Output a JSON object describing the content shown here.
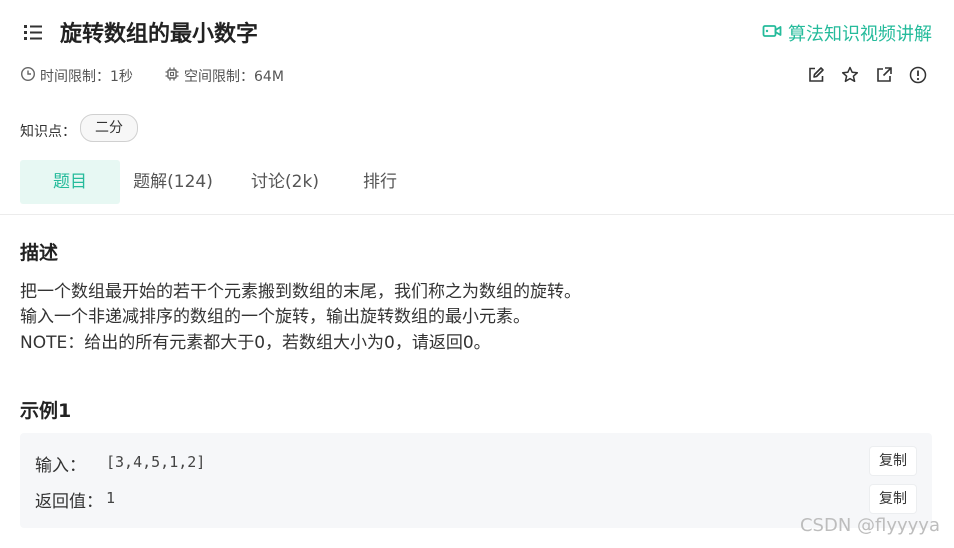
{
  "header": {
    "title": "旋转数组的最小数字",
    "video_label": "算法知识视频讲解"
  },
  "meta": {
    "time_limit": "时间限制：1秒",
    "memory_limit": "空间限制：64M"
  },
  "toolbar_icons": [
    "edit-icon",
    "star-icon",
    "share-icon",
    "report-icon"
  ],
  "knowledge": {
    "label": "知识点：",
    "tags": [
      "二分"
    ]
  },
  "tabs": [
    {
      "label": "题目",
      "active": true
    },
    {
      "label": "题解(124)",
      "active": false
    },
    {
      "label": "讨论(2k)",
      "active": false
    },
    {
      "label": "排行",
      "active": false
    }
  ],
  "description": {
    "title": "描述",
    "lines": [
      "把一个数组最开始的若干个元素搬到数组的末尾，我们称之为数组的旋转。",
      "输入一个非递减排序的数组的一个旋转，输出旋转数组的最小元素。",
      "NOTE：给出的所有元素都大于0，若数组大小为0，请返回0。"
    ]
  },
  "example": {
    "title": "示例1",
    "input_label": "输入：",
    "input_value": "[3,4,5,1,2]",
    "output_label": "返回值：",
    "output_value": "1",
    "copy_label": "复制"
  },
  "watermark": "CSDN @flyyyya",
  "colors": {
    "accent": "#25bb9b",
    "tab_active_bg": "#e7f8f3"
  }
}
